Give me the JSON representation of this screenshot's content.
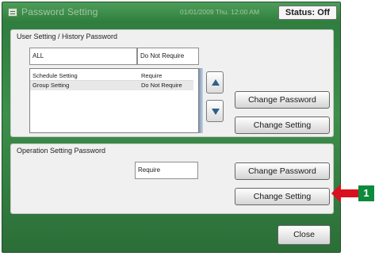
{
  "header": {
    "title": "Password Setting",
    "datetime": "01/01/2009 Thu. 12:00 AM",
    "status": "Status: Off"
  },
  "user_setting": {
    "section_label": "User Setting / History Password",
    "all_row": {
      "name": "ALL",
      "value": "Do Not Require"
    },
    "items": [
      {
        "name": "Schedule Setting",
        "value": "Require"
      },
      {
        "name": "Group Setting",
        "value": "Do Not Require"
      }
    ],
    "change_password_label": "Change Password",
    "change_setting_label": "Change Setting"
  },
  "operation_setting": {
    "section_label": "Operation Setting Password",
    "value": "Require",
    "change_password_label": "Change Password",
    "change_setting_label": "Change Setting"
  },
  "footer": {
    "close_label": "Close"
  },
  "callout": {
    "number": "1",
    "arrow_color": "#d9111f",
    "badge_color": "#0d8a3c"
  },
  "icons": {
    "title_icon": "keypad-icon",
    "scroll_up": "arrow-up-icon",
    "scroll_down": "arrow-down-icon"
  }
}
